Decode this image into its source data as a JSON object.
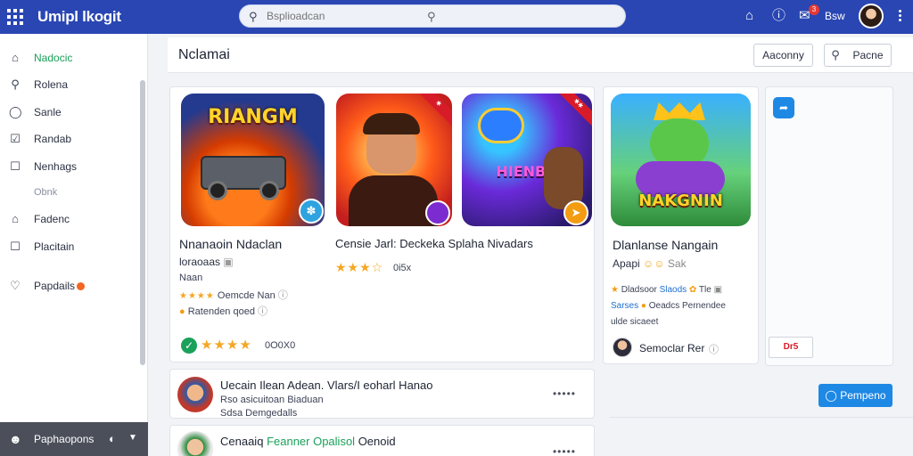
{
  "app": {
    "brand": "Umipl lkogit",
    "search_placeholder": "Bsplioadcan",
    "notifications_count": "3",
    "user_name": "Bsw"
  },
  "sidebar": {
    "items": [
      {
        "label": "Nadocic",
        "icon": "home-icon",
        "active": true
      },
      {
        "label": "Rolena",
        "icon": "search-icon"
      },
      {
        "label": "Sanle",
        "icon": "chat-icon"
      },
      {
        "label": "Randab",
        "icon": "check-square-icon"
      },
      {
        "label": "Nenhags",
        "icon": "square-icon"
      },
      {
        "label": "Obnk",
        "icon": "",
        "sub": true
      },
      {
        "label": "Fadenc",
        "icon": "home-icon"
      },
      {
        "label": "Placitain",
        "icon": "square-icon"
      },
      {
        "label": "Papdails",
        "icon": "tag-icon",
        "badge": true
      }
    ],
    "footer_label": "Paphaopons"
  },
  "main": {
    "title": "Nclamai",
    "btn_primary_outline": "Aaconny",
    "btn_secondary": "Pacne"
  },
  "featured": {
    "games": [
      {
        "art_title": "RIANGM"
      },
      {
        "art_title": ""
      },
      {
        "art_title": "HIENBH"
      }
    ],
    "title": "Nnanaoin Ndaclan",
    "subtitle": "loraoaas",
    "tag": "Naan",
    "line1": "Oemcde Nan",
    "line2": "Ratenden qoed",
    "rating_count": "0O0X0",
    "second_title": "Censie Jarl: Deckeka Splaha Nivadars",
    "second_rating": "0i5x"
  },
  "side_game": {
    "art_title": "NAKGNIN",
    "title": "Dlanlanse Nangain",
    "subtitle": "Apapi",
    "tag": "Sak",
    "line1_a": "Dladsoor",
    "line1_b": "Slaods",
    "line1_c": "Tle",
    "line2_a": "Sarses",
    "line2_b": "Oeadcs",
    "line2_c": "Pernendee",
    "line3": "ulde sicaeet",
    "author": "Semoclar Rer"
  },
  "side_panel": {
    "tag_image_label": "Dr5",
    "primary_button": "Pempeno"
  },
  "list": [
    {
      "title": "Uecain Ilean Adean. Vlars/I eoharl Hanao",
      "line1": "Rso asicuitoan Biaduan",
      "line2": "Sdsa Demgedalls"
    },
    {
      "title": "Cenaaiq",
      "highlight": "Feanner Opalisol",
      "title_end": "Oenoid",
      "line1": ""
    }
  ],
  "colors": {
    "topbar": "#2946b3",
    "accent_green": "#1aa15a",
    "primary_blue": "#1e88e5",
    "star": "#f5a623"
  }
}
